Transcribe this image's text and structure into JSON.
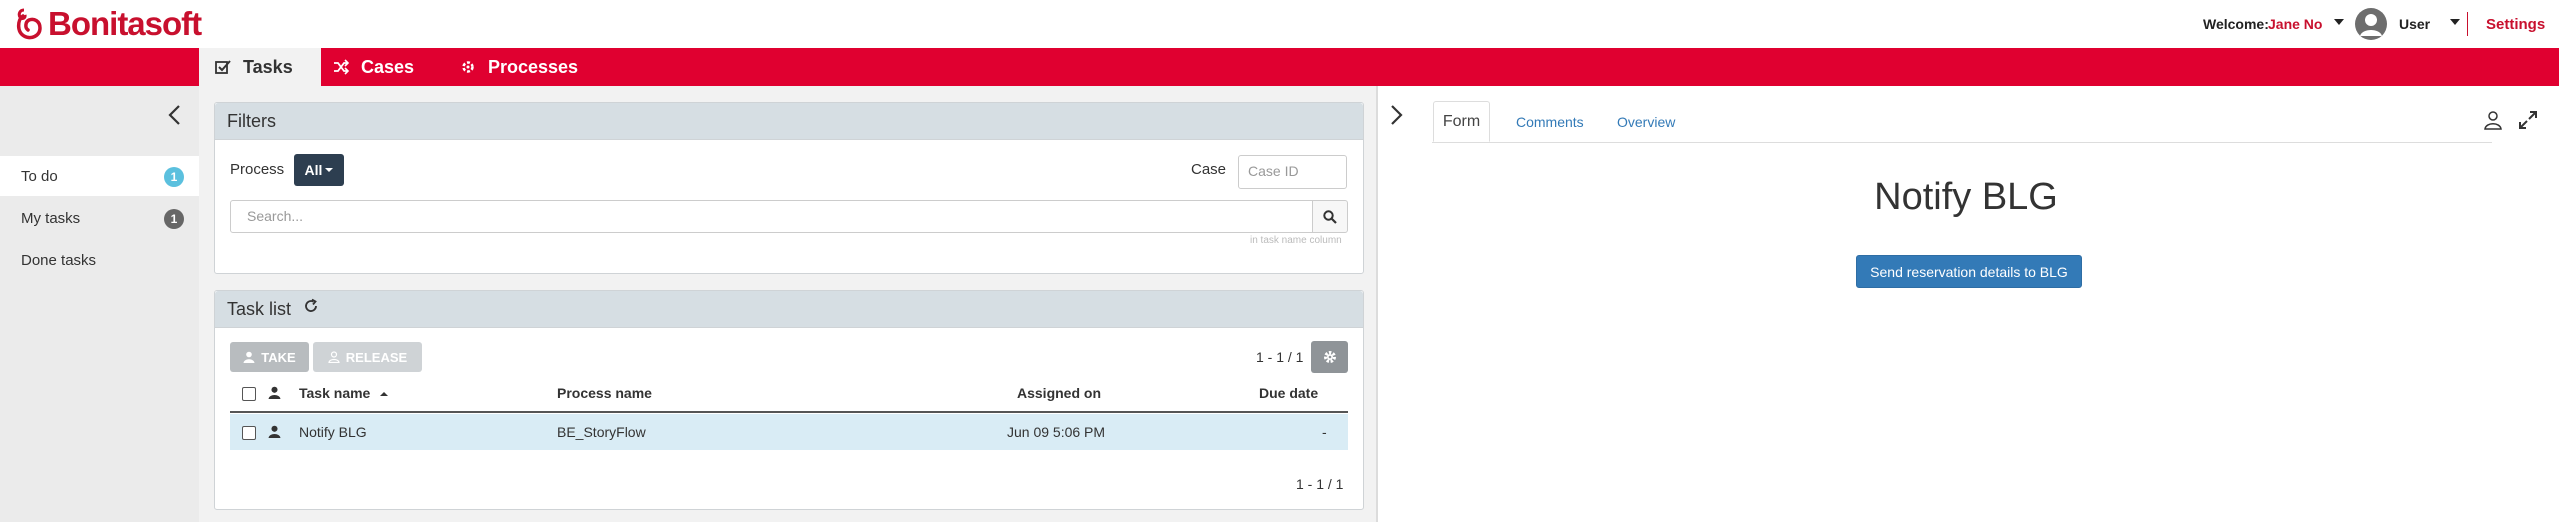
{
  "header": {
    "brand": "Bonitasoft",
    "welcome_label": "Welcome:",
    "user_name": "Jane No",
    "user_role": "User",
    "settings_label": "Settings"
  },
  "nav": {
    "tabs": [
      {
        "label": "Tasks",
        "icon": "check-square-icon",
        "active": true
      },
      {
        "label": "Cases",
        "icon": "shuffle-icon",
        "active": false
      },
      {
        "label": "Processes",
        "icon": "cogs-icon",
        "active": false
      }
    ]
  },
  "sidebar": {
    "items": [
      {
        "label": "To do",
        "count": "1",
        "active": true
      },
      {
        "label": "My tasks",
        "count": "1",
        "active": false
      },
      {
        "label": "Done tasks",
        "count": "",
        "active": false
      }
    ]
  },
  "filters": {
    "title": "Filters",
    "process_label": "Process",
    "process_value": "All",
    "case_label": "Case",
    "case_placeholder": "Case ID",
    "search_placeholder": "Search...",
    "search_hint": "in task name column"
  },
  "tasklist": {
    "title": "Task list",
    "take_label": "TAKE",
    "release_label": "RELEASE",
    "pager_top": "1 - 1 / 1",
    "pager_bottom": "1 - 1 / 1",
    "columns": [
      "Task name",
      "Process name",
      "Assigned on",
      "Due date"
    ],
    "rows": [
      {
        "task_name": "Notify BLG",
        "process_name": "BE_StoryFlow",
        "assigned_on": "Jun 09 5:06 PM",
        "due_date": "-"
      }
    ]
  },
  "detail": {
    "tabs": [
      "Form",
      "Comments",
      "Overview"
    ],
    "active_tab": "Form",
    "form_title": "Notify BLG",
    "form_button": "Send reservation details to BLG"
  },
  "colors": {
    "brand_red": "#e00030",
    "badge_info": "#5bc0de",
    "primary_button": "#337ab7",
    "row_highlight": "#d9ecf5"
  }
}
